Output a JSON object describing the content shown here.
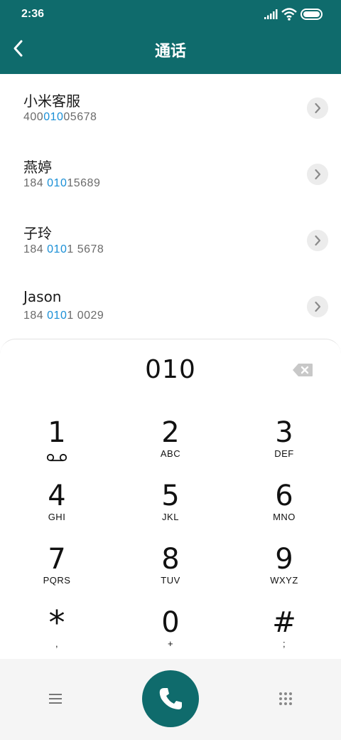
{
  "status_bar": {
    "time": "2:36"
  },
  "header": {
    "title": "通话"
  },
  "contacts": [
    {
      "name": "小米客服",
      "number_pre": "400",
      "number_match": "010",
      "number_post": "05678"
    },
    {
      "name": "燕婷",
      "number_pre": "184 ",
      "number_match": "010",
      "number_post": "15689"
    },
    {
      "name": "子玲",
      "number_pre": "184 ",
      "number_match": "010",
      "number_post": "1 5678"
    },
    {
      "name": "Jason",
      "number_pre": "184 ",
      "number_match": "010",
      "number_post": "1 0029"
    }
  ],
  "dialer": {
    "entered": "010",
    "keys": [
      {
        "digit": "1",
        "letters": ""
      },
      {
        "digit": "2",
        "letters": "ABC"
      },
      {
        "digit": "3",
        "letters": "DEF"
      },
      {
        "digit": "4",
        "letters": "GHI"
      },
      {
        "digit": "5",
        "letters": "JKL"
      },
      {
        "digit": "6",
        "letters": "MNO"
      },
      {
        "digit": "7",
        "letters": "PQRS"
      },
      {
        "digit": "8",
        "letters": "TUV"
      },
      {
        "digit": "9",
        "letters": "WXYZ"
      },
      {
        "digit": "*",
        "letters": ","
      },
      {
        "digit": "0",
        "letters": "+"
      },
      {
        "digit": "#",
        "letters": ";"
      }
    ]
  },
  "icons": {
    "back": "back-arrow-icon",
    "delete": "backspace-icon",
    "voicemail": "voicemail-icon",
    "menu": "menu-icon",
    "call": "phone-icon",
    "keypad": "keypad-icon"
  },
  "colors": {
    "accent": "#0f6b6c",
    "match": "#1a8fd6"
  }
}
